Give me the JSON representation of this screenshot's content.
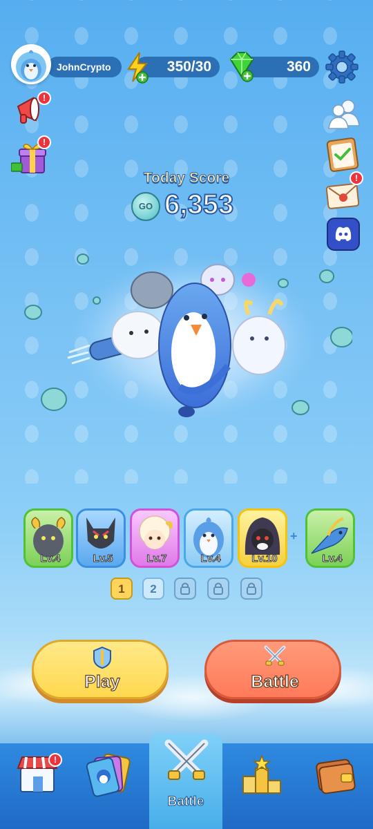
{
  "header": {
    "username": "JohnCrypto",
    "energy": "350/30",
    "gems": "360"
  },
  "score": {
    "title": "Today Score",
    "coin_label": "GO",
    "value": "6,353"
  },
  "left_icons": [
    {
      "name": "announcement-icon",
      "badge": "!"
    },
    {
      "name": "gift-icon",
      "badge": "!"
    }
  ],
  "right_icons": [
    {
      "name": "friends-icon",
      "badge": ""
    },
    {
      "name": "tasks-clipboard-icon",
      "badge": ""
    },
    {
      "name": "mail-icon",
      "badge": "!"
    },
    {
      "name": "discord-icon",
      "badge": ""
    }
  ],
  "roster": [
    {
      "level": "Lv.4",
      "border": "#4fc23a"
    },
    {
      "level": "Lv.5",
      "border": "#3a8fe0"
    },
    {
      "level": "Lv.7",
      "border": "#d052d8"
    },
    {
      "level": "Lv.4",
      "border": "#48a8e8"
    },
    {
      "level": "Lv.10",
      "border": "#f5c20c"
    },
    {
      "level": "Lv.4",
      "border": "#4fc23a"
    }
  ],
  "roster_plus": "+",
  "team_slots": [
    "1",
    "2"
  ],
  "buttons": {
    "play_label": "Play",
    "battle_label": "Battle"
  },
  "nav": {
    "active_label": "Battle",
    "items": [
      "shop-icon",
      "cards-icon",
      "battle-swords-icon",
      "leaderboard-icon",
      "wallet-icon"
    ],
    "shop_badge": "!"
  },
  "colors": {
    "play_button": "#ffd84e",
    "battle_button": "#ff7a5a",
    "pill": "#2b6fb4",
    "badge": "#f0323c"
  }
}
